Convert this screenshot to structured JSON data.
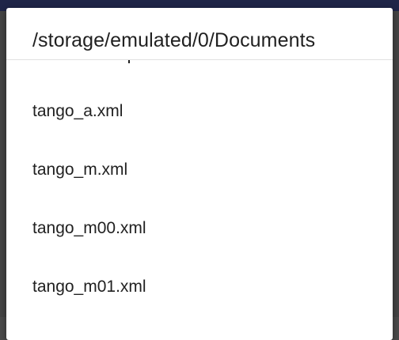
{
  "dialog": {
    "title": "/storage/emulated/0/Documents",
    "files": [
      {
        "name": "tango_a.xml"
      },
      {
        "name": "tango_m.xml"
      },
      {
        "name": "tango_m00.xml"
      },
      {
        "name": "tango_m01.xml"
      }
    ]
  }
}
